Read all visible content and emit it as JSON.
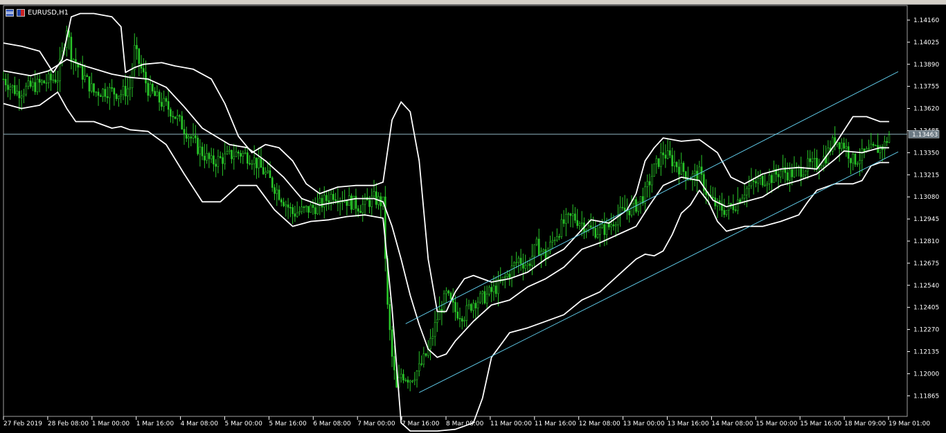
{
  "window": {
    "title": "EURUSD,H1"
  },
  "colors": {
    "background": "#000000",
    "candle": "#29c729",
    "band": "#ffffff",
    "channel": "#5fc8e6",
    "price_line": "#8fb4c0",
    "axis": "#ffffff"
  },
  "chart_data": {
    "type": "candlestick",
    "symbol": "EURUSD",
    "timeframe": "H1",
    "ylim": [
      1.1178,
      1.1425
    ],
    "y_ticks": [
      "1.14160",
      "1.14025",
      "1.13890",
      "1.13755",
      "1.13620",
      "1.13485",
      "1.13350",
      "1.13215",
      "1.13080",
      "1.12945",
      "1.12810",
      "1.12675",
      "1.12540",
      "1.12405",
      "1.12270",
      "1.12135",
      "1.12000",
      "1.11865"
    ],
    "x_ticks": [
      "27 Feb 2019",
      "28 Feb 08:00",
      "1 Mar 00:00",
      "1 Mar 16:00",
      "4 Mar 08:00",
      "5 Mar 00:00",
      "5 Mar 16:00",
      "6 Mar 08:00",
      "7 Mar 00:00",
      "7 Mar 16:00",
      "8 Mar 08:00",
      "11 Mar 00:00",
      "11 Mar 16:00",
      "12 Mar 08:00",
      "13 Mar 00:00",
      "13 Mar 16:00",
      "14 Mar 08:00",
      "15 Mar 00:00",
      "15 Mar 16:00",
      "18 Mar 09:00",
      "19 Mar 01:00"
    ],
    "current_price": "1.13463",
    "close_path": [
      [
        0,
        1.138
      ],
      [
        3,
        1.1372
      ],
      [
        6,
        1.1375
      ],
      [
        9,
        1.1378
      ],
      [
        12,
        1.1381
      ],
      [
        13,
        1.1395
      ],
      [
        14,
        1.1412
      ],
      [
        15,
        1.1395
      ],
      [
        17,
        1.1385
      ],
      [
        20,
        1.1372
      ],
      [
        23,
        1.1373
      ],
      [
        26,
        1.1371
      ],
      [
        28,
        1.1375
      ],
      [
        29,
        1.1398
      ],
      [
        30,
        1.139
      ],
      [
        32,
        1.1374
      ],
      [
        34,
        1.1368
      ],
      [
        37,
        1.1361
      ],
      [
        40,
        1.135
      ],
      [
        43,
        1.1338
      ],
      [
        46,
        1.1329
      ],
      [
        49,
        1.1332
      ],
      [
        52,
        1.1335
      ],
      [
        55,
        1.1332
      ],
      [
        58,
        1.1322
      ],
      [
        61,
        1.131
      ],
      [
        64,
        1.1298
      ],
      [
        67,
        1.13
      ],
      [
        70,
        1.1303
      ],
      [
        73,
        1.131
      ],
      [
        76,
        1.1306
      ],
      [
        79,
        1.1302
      ],
      [
        82,
        1.1307
      ],
      [
        84,
        1.1304
      ],
      [
        85,
        1.124
      ],
      [
        86,
        1.121
      ],
      [
        87,
        1.119
      ],
      [
        88,
        1.12
      ],
      [
        90,
        1.1197
      ],
      [
        92,
        1.1203
      ],
      [
        94,
        1.1214
      ],
      [
        96,
        1.1234
      ],
      [
        98,
        1.1248
      ],
      [
        100,
        1.1238
      ],
      [
        102,
        1.1236
      ],
      [
        104,
        1.1244
      ],
      [
        106,
        1.1246
      ],
      [
        108,
        1.125
      ],
      [
        110,
        1.1255
      ],
      [
        112,
        1.1262
      ],
      [
        114,
        1.127
      ],
      [
        116,
        1.1266
      ],
      [
        118,
        1.1278
      ],
      [
        120,
        1.1272
      ],
      [
        122,
        1.1284
      ],
      [
        124,
        1.1292
      ],
      [
        126,
        1.1296
      ],
      [
        128,
        1.1292
      ],
      [
        130,
        1.1288
      ],
      [
        132,
        1.1287
      ],
      [
        134,
        1.129
      ],
      [
        136,
        1.1297
      ],
      [
        138,
        1.13
      ],
      [
        140,
        1.1303
      ],
      [
        142,
        1.131
      ],
      [
        144,
        1.1325
      ],
      [
        146,
        1.1335
      ],
      [
        148,
        1.133
      ],
      [
        150,
        1.1325
      ],
      [
        152,
        1.132
      ],
      [
        154,
        1.1322
      ],
      [
        156,
        1.1308
      ],
      [
        158,
        1.1302
      ],
      [
        160,
        1.13
      ],
      [
        162,
        1.1304
      ],
      [
        164,
        1.1312
      ],
      [
        166,
        1.1316
      ],
      [
        168,
        1.1319
      ],
      [
        170,
        1.132
      ],
      [
        172,
        1.1324
      ],
      [
        174,
        1.1322
      ],
      [
        176,
        1.1324
      ],
      [
        178,
        1.1327
      ],
      [
        180,
        1.1328
      ],
      [
        182,
        1.1333
      ],
      [
        184,
        1.1343
      ],
      [
        186,
        1.134
      ],
      [
        188,
        1.133
      ],
      [
        190,
        1.1333
      ],
      [
        192,
        1.1336
      ],
      [
        194,
        1.1338
      ],
      [
        195,
        1.134
      ],
      [
        196,
        1.1346
      ]
    ],
    "middle_band": [
      [
        0,
        1.1385
      ],
      [
        6,
        1.1382
      ],
      [
        10,
        1.1385
      ],
      [
        14,
        1.1392
      ],
      [
        18,
        1.1388
      ],
      [
        24,
        1.1383
      ],
      [
        28,
        1.1381
      ],
      [
        32,
        1.138
      ],
      [
        36,
        1.1375
      ],
      [
        40,
        1.1363
      ],
      [
        44,
        1.135
      ],
      [
        50,
        1.134
      ],
      [
        54,
        1.1338
      ],
      [
        58,
        1.133
      ],
      [
        62,
        1.132
      ],
      [
        66,
        1.1307
      ],
      [
        70,
        1.1303
      ],
      [
        74,
        1.1305
      ],
      [
        78,
        1.1307
      ],
      [
        82,
        1.1307
      ],
      [
        84,
        1.1305
      ],
      [
        86,
        1.129
      ],
      [
        88,
        1.127
      ],
      [
        90,
        1.1248
      ],
      [
        92,
        1.123
      ],
      [
        94,
        1.1215
      ],
      [
        96,
        1.121
      ],
      [
        98,
        1.1212
      ],
      [
        100,
        1.122
      ],
      [
        104,
        1.1232
      ],
      [
        108,
        1.1242
      ],
      [
        112,
        1.1245
      ],
      [
        116,
        1.1253
      ],
      [
        120,
        1.1258
      ],
      [
        124,
        1.1265
      ],
      [
        128,
        1.1276
      ],
      [
        132,
        1.128
      ],
      [
        136,
        1.1285
      ],
      [
        140,
        1.129
      ],
      [
        143,
        1.1303
      ],
      [
        146,
        1.1315
      ],
      [
        150,
        1.132
      ],
      [
        154,
        1.1318
      ],
      [
        157,
        1.1306
      ],
      [
        160,
        1.1302
      ],
      [
        164,
        1.1305
      ],
      [
        168,
        1.1308
      ],
      [
        172,
        1.1315
      ],
      [
        176,
        1.1318
      ],
      [
        180,
        1.1322
      ],
      [
        184,
        1.1331
      ],
      [
        186,
        1.1336
      ],
      [
        190,
        1.1335
      ],
      [
        194,
        1.1338
      ],
      [
        196,
        1.1338
      ]
    ],
    "upper_band": [
      [
        0,
        1.1402
      ],
      [
        4,
        1.14
      ],
      [
        8,
        1.1397
      ],
      [
        11,
        1.1384
      ],
      [
        13,
        1.1392
      ],
      [
        15,
        1.1418
      ],
      [
        17,
        1.142
      ],
      [
        20,
        1.142
      ],
      [
        24,
        1.1418
      ],
      [
        26,
        1.1412
      ],
      [
        27,
        1.1384
      ],
      [
        29,
        1.1387
      ],
      [
        31,
        1.1389
      ],
      [
        35,
        1.139
      ],
      [
        38,
        1.1388
      ],
      [
        42,
        1.1386
      ],
      [
        46,
        1.138
      ],
      [
        49,
        1.1365
      ],
      [
        52,
        1.1345
      ],
      [
        55,
        1.1335
      ],
      [
        58,
        1.134
      ],
      [
        61,
        1.1338
      ],
      [
        64,
        1.133
      ],
      [
        67,
        1.1316
      ],
      [
        70,
        1.131
      ],
      [
        74,
        1.1314
      ],
      [
        78,
        1.1315
      ],
      [
        82,
        1.1315
      ],
      [
        84,
        1.1317
      ],
      [
        86,
        1.1355
      ],
      [
        88,
        1.1366
      ],
      [
        90,
        1.136
      ],
      [
        92,
        1.133
      ],
      [
        94,
        1.127
      ],
      [
        96,
        1.1238
      ],
      [
        98,
        1.1238
      ],
      [
        100,
        1.125
      ],
      [
        102,
        1.1258
      ],
      [
        104,
        1.126
      ],
      [
        108,
        1.1256
      ],
      [
        112,
        1.1258
      ],
      [
        116,
        1.1262
      ],
      [
        120,
        1.127
      ],
      [
        124,
        1.1276
      ],
      [
        128,
        1.1288
      ],
      [
        130,
        1.1294
      ],
      [
        134,
        1.1292
      ],
      [
        138,
        1.13
      ],
      [
        140,
        1.131
      ],
      [
        142,
        1.133
      ],
      [
        144,
        1.1338
      ],
      [
        146,
        1.1344
      ],
      [
        150,
        1.1342
      ],
      [
        154,
        1.1343
      ],
      [
        158,
        1.1335
      ],
      [
        161,
        1.132
      ],
      [
        164,
        1.1316
      ],
      [
        168,
        1.1322
      ],
      [
        172,
        1.1325
      ],
      [
        176,
        1.1326
      ],
      [
        180,
        1.1325
      ],
      [
        184,
        1.134
      ],
      [
        188,
        1.1357
      ],
      [
        191,
        1.1357
      ],
      [
        194,
        1.1354
      ],
      [
        196,
        1.1354
      ]
    ],
    "lower_band": [
      [
        0,
        1.1365
      ],
      [
        4,
        1.1362
      ],
      [
        8,
        1.1364
      ],
      [
        12,
        1.1372
      ],
      [
        14,
        1.1362
      ],
      [
        16,
        1.1354
      ],
      [
        20,
        1.1354
      ],
      [
        24,
        1.135
      ],
      [
        26,
        1.1351
      ],
      [
        28,
        1.1349
      ],
      [
        32,
        1.1348
      ],
      [
        36,
        1.134
      ],
      [
        40,
        1.1322
      ],
      [
        44,
        1.1305
      ],
      [
        48,
        1.1305
      ],
      [
        52,
        1.1315
      ],
      [
        56,
        1.1315
      ],
      [
        60,
        1.13
      ],
      [
        64,
        1.129
      ],
      [
        68,
        1.1293
      ],
      [
        72,
        1.1294
      ],
      [
        76,
        1.1296
      ],
      [
        80,
        1.1297
      ],
      [
        84,
        1.1295
      ],
      [
        86,
        1.124
      ],
      [
        88,
        1.117
      ],
      [
        90,
        1.1165
      ],
      [
        92,
        1.1165
      ],
      [
        96,
        1.1165
      ],
      [
        100,
        1.1166
      ],
      [
        104,
        1.117
      ],
      [
        106,
        1.1185
      ],
      [
        108,
        1.121
      ],
      [
        112,
        1.1225
      ],
      [
        116,
        1.1228
      ],
      [
        120,
        1.1232
      ],
      [
        124,
        1.1236
      ],
      [
        128,
        1.1245
      ],
      [
        132,
        1.125
      ],
      [
        136,
        1.126
      ],
      [
        140,
        1.127
      ],
      [
        142,
        1.1273
      ],
      [
        144,
        1.1272
      ],
      [
        146,
        1.1275
      ],
      [
        148,
        1.1285
      ],
      [
        150,
        1.1298
      ],
      [
        152,
        1.1303
      ],
      [
        154,
        1.1312
      ],
      [
        156,
        1.1305
      ],
      [
        158,
        1.1293
      ],
      [
        160,
        1.1287
      ],
      [
        164,
        1.129
      ],
      [
        168,
        1.129
      ],
      [
        172,
        1.1293
      ],
      [
        176,
        1.1297
      ],
      [
        178,
        1.1305
      ],
      [
        180,
        1.1312
      ],
      [
        184,
        1.1316
      ],
      [
        188,
        1.1316
      ],
      [
        190,
        1.1318
      ],
      [
        192,
        1.1327
      ],
      [
        194,
        1.1329
      ],
      [
        196,
        1.1329
      ]
    ],
    "channel_lines": [
      {
        "from": [
          89,
          1.12305
        ],
        "to": [
          198,
          1.13845
        ]
      },
      {
        "from": [
          92,
          1.11885
        ],
        "to": [
          198,
          1.13355
        ]
      }
    ]
  }
}
